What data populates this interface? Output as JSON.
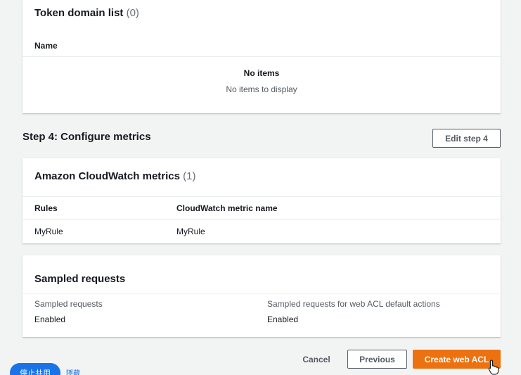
{
  "token_domain": {
    "title": "Token domain list",
    "count": "(0)",
    "column_name": "Name",
    "empty_title": "No items",
    "empty_text": "No items to display"
  },
  "step4": {
    "title": "Step 4: Configure metrics",
    "edit_button": "Edit step 4"
  },
  "cloudwatch": {
    "title": "Amazon CloudWatch metrics",
    "count": "(1)",
    "col_rules": "Rules",
    "col_metric": "CloudWatch metric name",
    "rows": [
      {
        "rule": "MyRule",
        "metric": "MyRule"
      }
    ]
  },
  "sampled": {
    "title": "Sampled requests",
    "left_label": "Sampled requests",
    "left_value": "Enabled",
    "right_label": "Sampled requests for web ACL default actions",
    "right_value": "Enabled"
  },
  "footer": {
    "cancel": "Cancel",
    "previous": "Previous",
    "create": "Create web ACL"
  },
  "share_bar": {
    "stop_share": "停止共用",
    "hide": "隱藏"
  },
  "colors": {
    "primary": "#ec7211",
    "share": "#1a73e8"
  }
}
